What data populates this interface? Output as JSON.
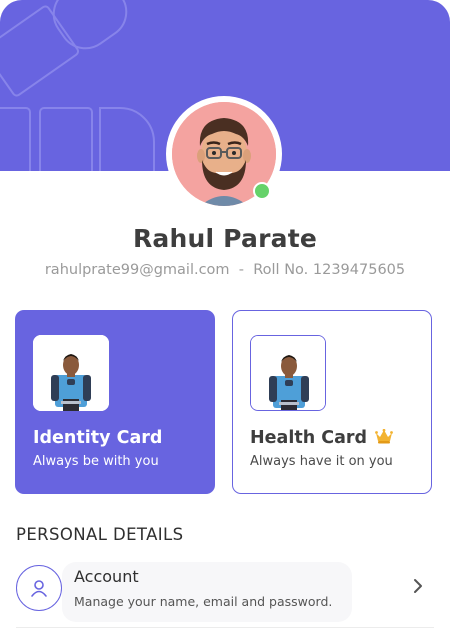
{
  "profile": {
    "name": "Rahul Parate",
    "email": "rahulprate99@gmail.com",
    "separator": "  -  ",
    "roll": "Roll No. 1239475605",
    "online": true
  },
  "cards": {
    "identity": {
      "title": "Identity Card",
      "subtitle": "Always be with you"
    },
    "health": {
      "title": "Health Card",
      "subtitle": "Always have it on you",
      "badge_icon": "crown-icon"
    }
  },
  "personal_details": {
    "heading": "PERSONAL DETAILS",
    "items": [
      {
        "title": "Account",
        "subtitle": "Manage your name, email and password.",
        "icon": "user-icon"
      }
    ]
  },
  "colors": {
    "accent": "#6864e0",
    "online": "#66d26a",
    "avatar_bg": "#f4a3a0"
  }
}
